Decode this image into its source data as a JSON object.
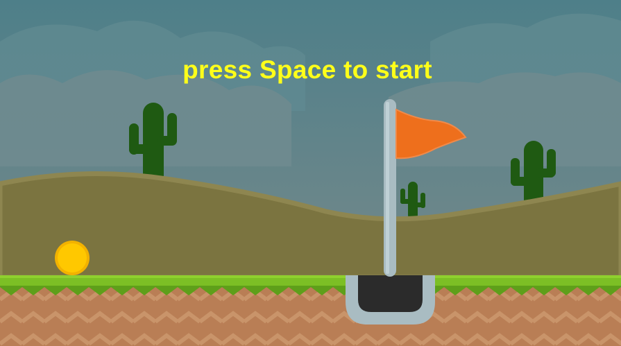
{
  "game": {
    "start_prompt": "press Space to start"
  },
  "colors": {
    "sky_top": "#4e7f89",
    "sky_bottom": "#7b8a8c",
    "cloud": "#6b8a90",
    "hill": "#7b7440",
    "hill_edge": "#8e8650",
    "cactus": "#1f5a12",
    "grass": "#7cbf25",
    "grass_dark": "#5e9f1a",
    "dirt": "#b97e55",
    "dirt_zigzag": "#c9946a",
    "ball": "#ffc800",
    "ball_rim": "#f2b200",
    "flag": "#ee6f1c",
    "pole": "#a9bcc2",
    "cup_rim": "#a9bcc2",
    "hole": "#2b2b2b",
    "prompt_text": "#ffff1a"
  },
  "icons": [
    "golf-ball-icon",
    "golf-flag-icon",
    "cactus-icon",
    "golf-hole-icon"
  ]
}
